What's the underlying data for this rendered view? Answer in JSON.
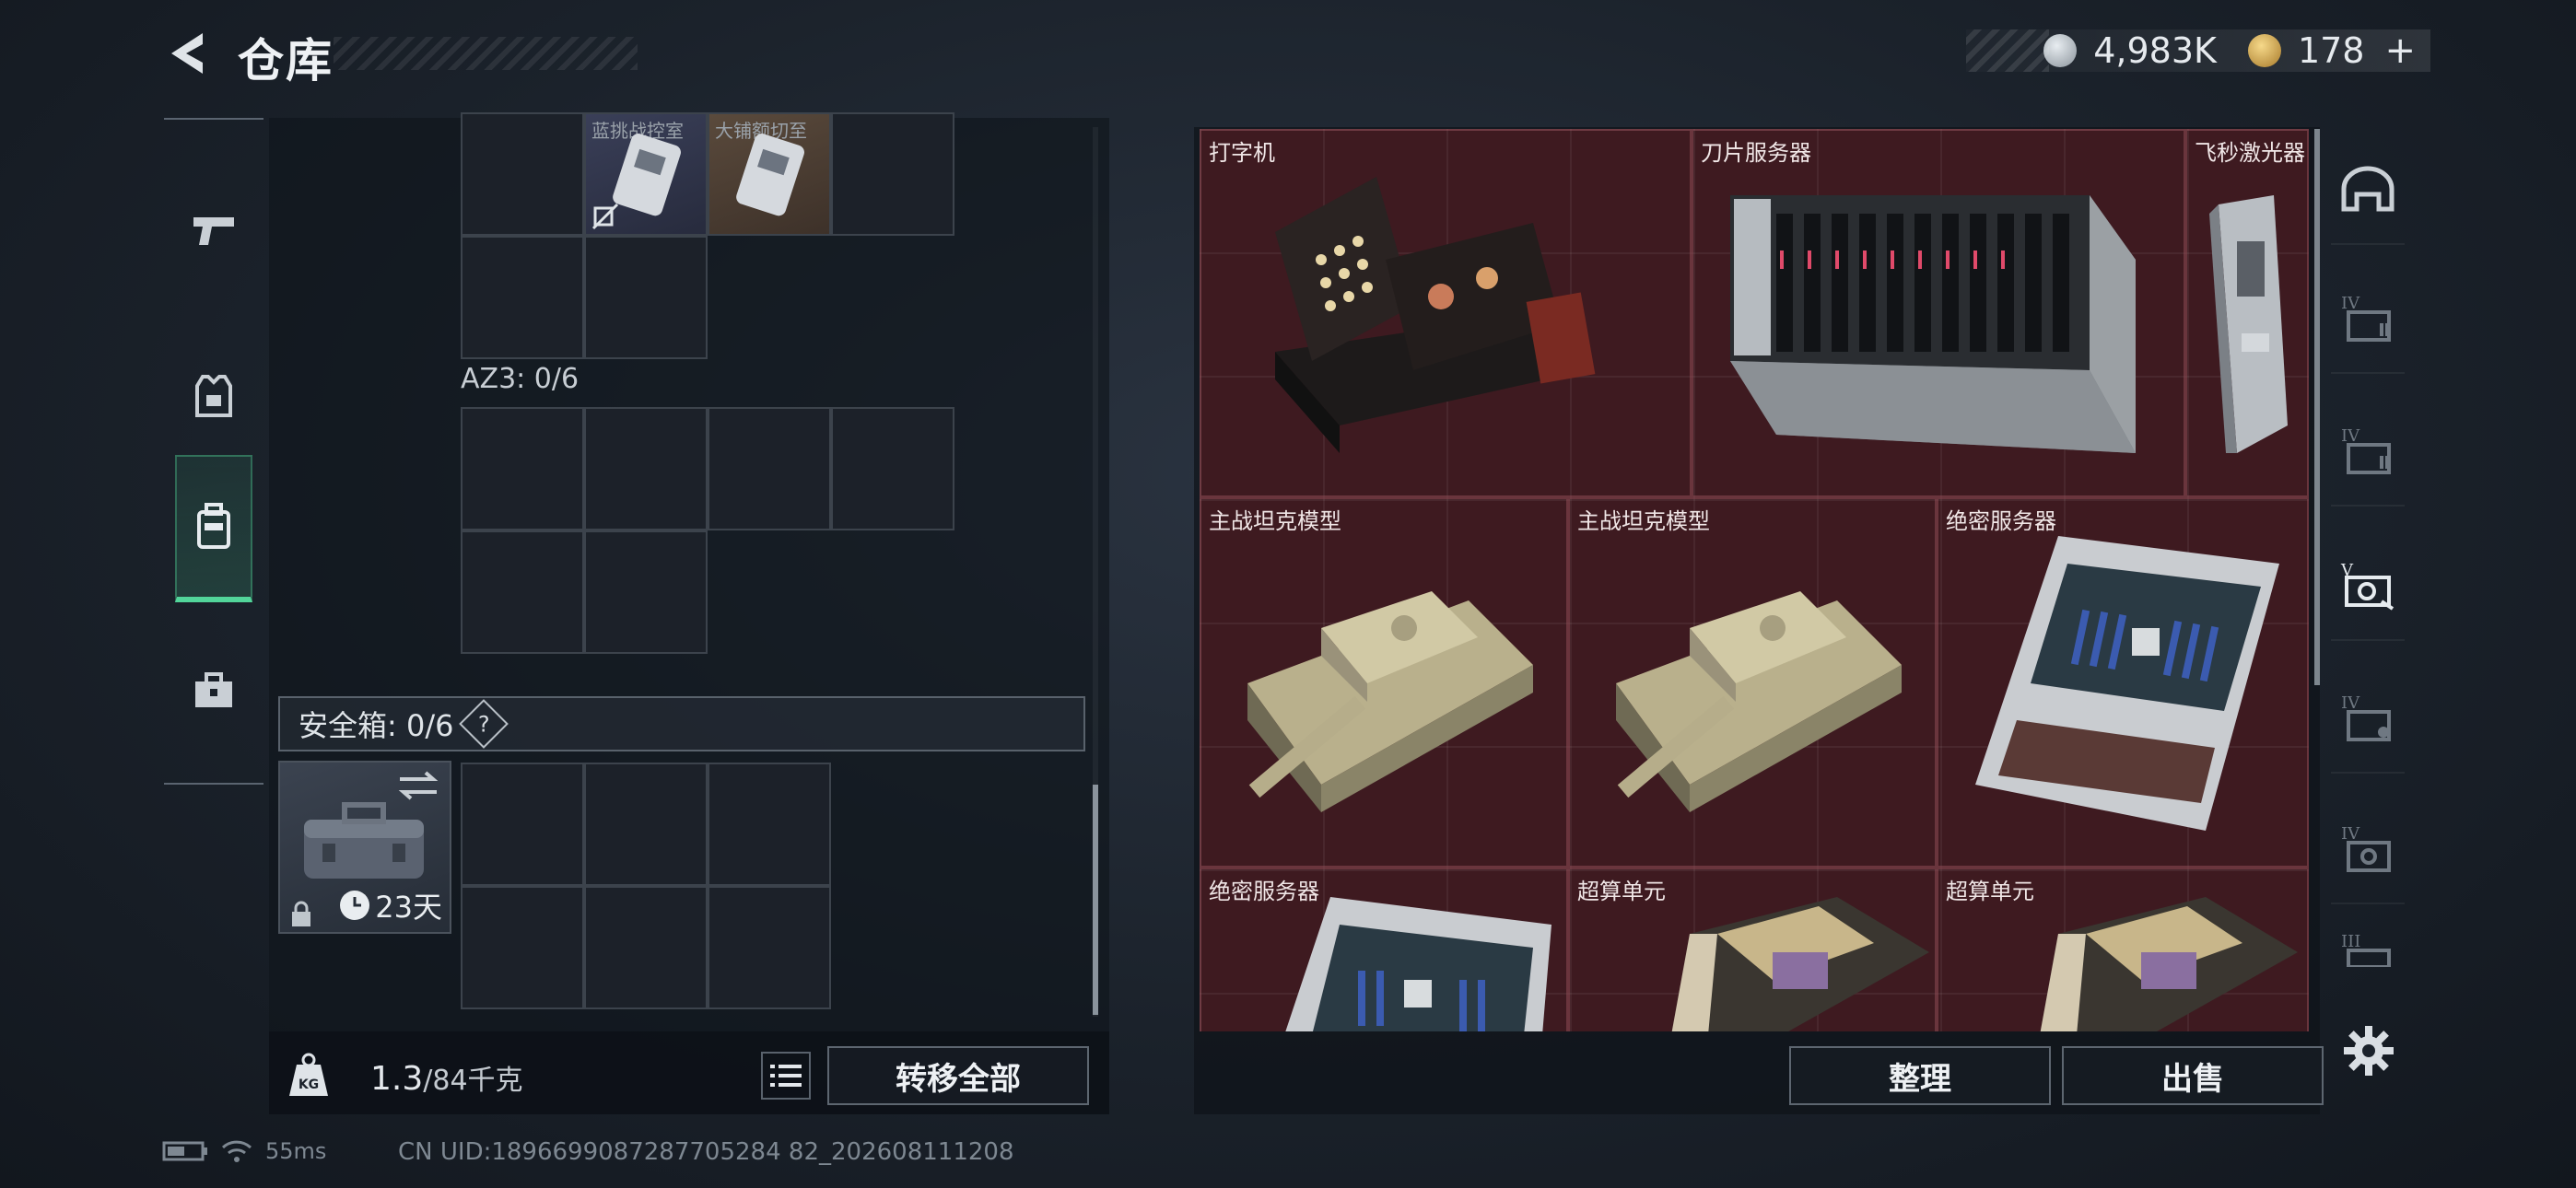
{
  "header": {
    "title": "仓库",
    "silver_value": "4,983K",
    "gold_value": "178",
    "plus_label": "+"
  },
  "left_nav": {
    "items": [
      {
        "name": "weapon",
        "icon": "pistol-icon"
      },
      {
        "name": "gear",
        "icon": "armor-vest-icon"
      },
      {
        "name": "backpack",
        "icon": "backpack-icon",
        "active": true
      },
      {
        "name": "case",
        "icon": "briefcase-icon"
      }
    ]
  },
  "inventory": {
    "partial_item_labels": [
      "蓝挑战控室",
      "大铺额切至"
    ],
    "az3_label": "AZ3: 0/6",
    "safe_box_label": "安全箱: 0/6",
    "help_label": "?",
    "safe_days": "23天",
    "weight_value": "1.3",
    "weight_capacity": "/84千克",
    "transfer_all_label": "转移全部"
  },
  "loot": {
    "items": [
      {
        "label": "打字机"
      },
      {
        "label": "刀片服务器"
      },
      {
        "label": "飞秒激光器"
      },
      {
        "label": "主战坦克模型"
      },
      {
        "label": "主战坦克模型"
      },
      {
        "label": "绝密服务器"
      },
      {
        "label": "绝密服务器"
      },
      {
        "label": "超算单元"
      },
      {
        "label": "超算单元"
      }
    ],
    "sort_label": "整理",
    "sell_label": "出售"
  },
  "right_nav": {
    "items": [
      "helmet-icon",
      "folder-iv-icon",
      "folder-iv-icon",
      "camera-folder-icon",
      "folder-iv-icon",
      "folder-iv-icon",
      "folder-iii-icon"
    ]
  },
  "status_bar": {
    "ping": "55ms",
    "uid": "CN UID:1896699087287705284 82_202608111208"
  },
  "colors": {
    "accent_green": "#52d59a",
    "loot_bg": "#3e1a20"
  }
}
